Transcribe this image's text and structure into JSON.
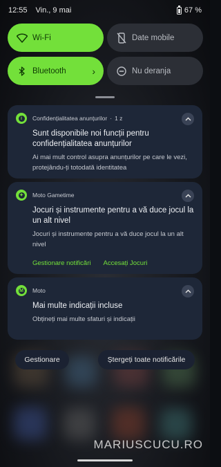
{
  "status_bar": {
    "time": "12:55",
    "date": "Vin., 9 mai",
    "battery": "67 %"
  },
  "quick_tiles": [
    {
      "label": "Wi-Fi",
      "icon": "wifi-icon",
      "state": "on"
    },
    {
      "label": "Date mobile",
      "icon": "mobile-data-off-icon",
      "state": "off"
    },
    {
      "label": "Bluetooth",
      "icon": "bluetooth-icon",
      "state": "on",
      "chevron": "›"
    },
    {
      "label": "Nu deranja",
      "icon": "do-not-disturb-icon",
      "state": "off"
    }
  ],
  "notifications": [
    {
      "app": "Confidențialitatea anunțurilor",
      "meta": "1 z",
      "title": "Sunt disponibile noi funcții pentru confidențialitatea anunțurilor",
      "text": "Ai mai mult control asupra anunțurilor pe care le vezi, protejându-ți totodată identitatea",
      "actions": []
    },
    {
      "app": "Moto Gametime",
      "meta": "",
      "title": "Jocuri și instrumente pentru a vă duce jocul la un alt nivel",
      "text": "Jocuri și instrumente pentru a vă duce jocul la un alt nivel",
      "actions": [
        "Gestionare notificări",
        "Accesați Jocuri"
      ]
    },
    {
      "app": "Moto",
      "meta": "",
      "title": "Mai multe indicații incluse",
      "text": "Obțineți mai multe sfaturi și indicații",
      "actions": []
    }
  ],
  "footer_buttons": {
    "manage": "Gestionare",
    "clear_all": "Ștergeți toate notificările"
  },
  "watermark": "MARIUSCUCU.RO",
  "colors": {
    "accent": "#73e03a",
    "card": "#1e2738",
    "tile_off": "#2c2f36"
  }
}
